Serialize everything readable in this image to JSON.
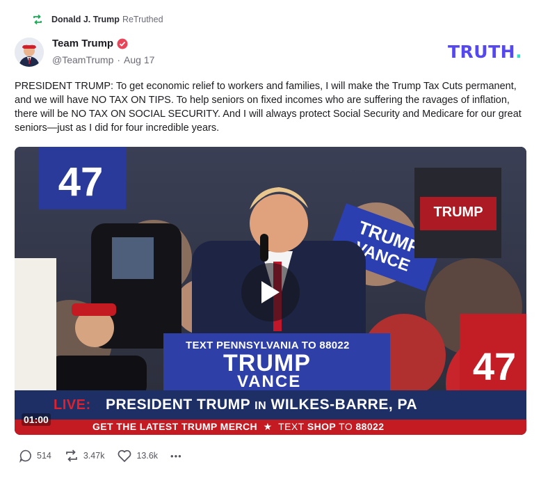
{
  "retruth": {
    "name": "Donald J. Trump",
    "label": "ReTruthed",
    "icon": "retruth-icon"
  },
  "author": {
    "display_name": "Team Trump",
    "handle": "@TeamTrump",
    "date": "Aug 17",
    "verified_icon": "verified-icon",
    "avatar_icon": "avatar"
  },
  "brand": {
    "logo_text": "TRUTH",
    "logo_dot": ".",
    "color": "#5448ee",
    "dot_color": "#2ee1c8"
  },
  "post": {
    "text": "PRESIDENT TRUMP: To get economic relief to workers and families, I will make the Trump Tax Cuts permanent, and we will have NO TAX ON TIPS. To help seniors on fixed incomes who are suffering the ravages of inflation, there will be NO TAX ON SOCIAL SECURITY. And I will always protect Social Security and Medicare for our great seniors—just as I did for four incredible years."
  },
  "video": {
    "timestamp": "01:00",
    "live_label": "LIVE:",
    "headline_part1": "PRESIDENT TRUMP",
    "headline_in": "IN",
    "headline_part2": "WILKES-BARRE, PA",
    "sub_part1": "GET THE LATEST TRUMP MERCH",
    "sub_star": "★",
    "sub_text": "TEXT",
    "sub_shop": "SHOP",
    "sub_to": "TO",
    "sub_number": "88022",
    "podium_line1": "TEXT PENNSYLVANIA TO 88022",
    "podium_trump": "TRUMP",
    "podium_vance": "VANCE",
    "sign_47": "47",
    "sign_trump": "TRUMP",
    "sign_vance": "VANCE"
  },
  "actions": {
    "replies": "514",
    "retruths": "3.47k",
    "likes": "13.6k",
    "more": "•••"
  }
}
